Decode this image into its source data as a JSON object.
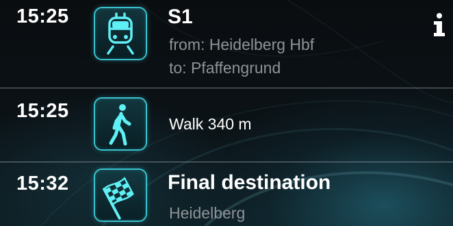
{
  "info_button": {
    "label": "i"
  },
  "legs": [
    {
      "time": "15:25",
      "icon": "train-icon",
      "title": "S1",
      "from_label": "from: Heidelberg Hbf",
      "to_label": "to: Pfaffengrund"
    },
    {
      "time": "15:25",
      "icon": "walk-icon",
      "text": "Walk 340 m"
    },
    {
      "time": "15:32",
      "icon": "checkered-flag-icon",
      "title": "Final destination",
      "subtitle": "Heidelberg"
    }
  ],
  "colors": {
    "accent": "#39c3cf",
    "subtext": "#8d9499",
    "background": "#0b1216"
  }
}
